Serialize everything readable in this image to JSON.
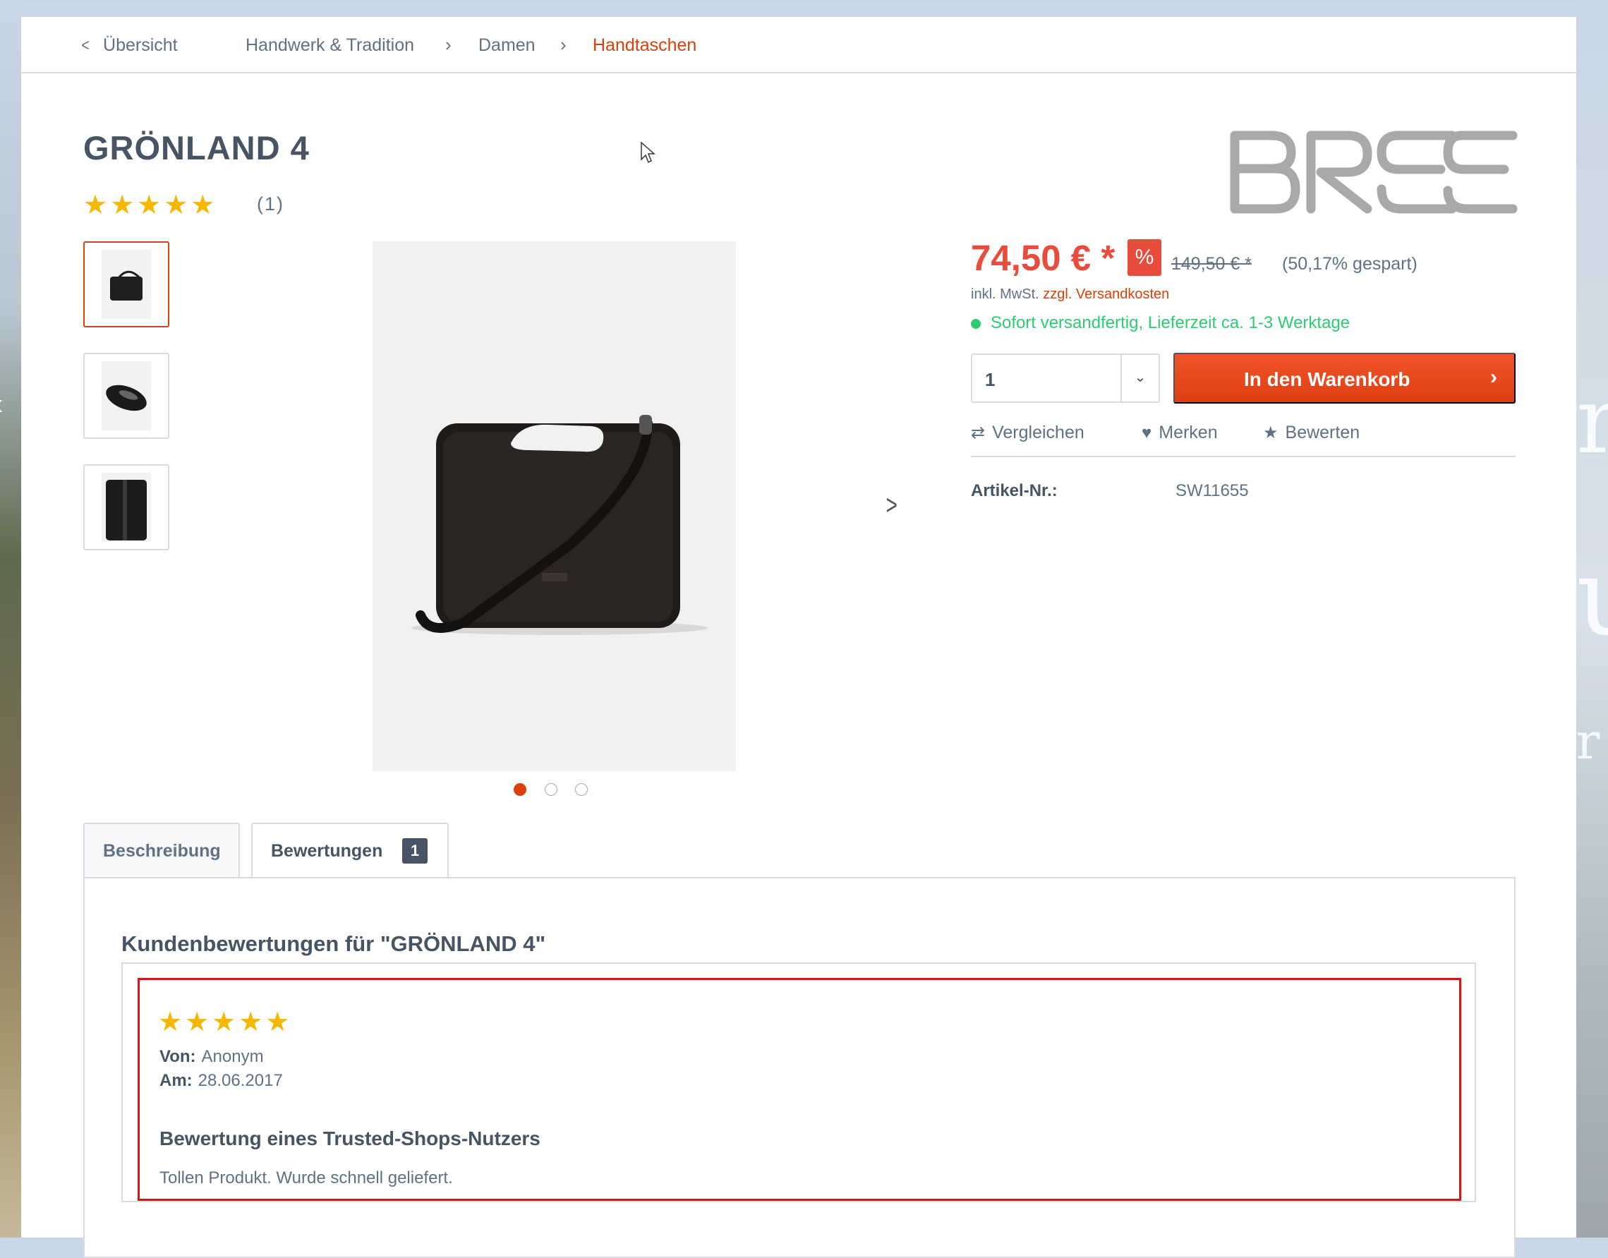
{
  "breadcrumb": {
    "back_label": "Übersicht",
    "items": [
      "Handwerk & Tradition",
      "Damen",
      "Handtaschen"
    ]
  },
  "product": {
    "title": "GRÖNLAND 4",
    "rating_stars": 5,
    "stars_glyphs": "★★★★★",
    "rating_count": "(1)",
    "brand_logo_text": "BREE"
  },
  "gallery": {
    "thumbnail_count": 3,
    "active_index": 0,
    "dots": 3
  },
  "buybox": {
    "price": "74,50 € *",
    "discount_badge": "%",
    "old_price": "149,50 € *",
    "saved": "(50,17% gespart)",
    "tax_prefix": "inkl. MwSt.",
    "shipping_link": "zzgl. Versandkosten",
    "delivery": "Sofort versandfertig, Lieferzeit ca. 1-3 Werktage",
    "quantity": "1",
    "add_to_cart": "In den Warenkorb",
    "actions": {
      "compare": "Vergleichen",
      "wishlist": "Merken",
      "rate": "Bewerten"
    },
    "sku_label": "Artikel-Nr.:",
    "sku_value": "SW11655"
  },
  "tabs": {
    "description": "Beschreibung",
    "reviews": "Bewertungen",
    "reviews_count": "1"
  },
  "reviews": {
    "heading": "Kundenbewertungen für \"GRÖNLAND 4\"",
    "items": [
      {
        "stars": 5,
        "from_label": "Von:",
        "from_value": "Anonym",
        "date_label": "Am:",
        "date_value": "28.06.2017",
        "title": "Bewertung eines Trusted-Shops-Nutzers",
        "text": "Tollen Produkt. Wurde schnell geliefert."
      }
    ]
  },
  "colors": {
    "accent": "#d9400b",
    "price": "#e74c3c",
    "in_stock": "#2ecc71",
    "star": "#f5b700",
    "text": "#475463"
  }
}
